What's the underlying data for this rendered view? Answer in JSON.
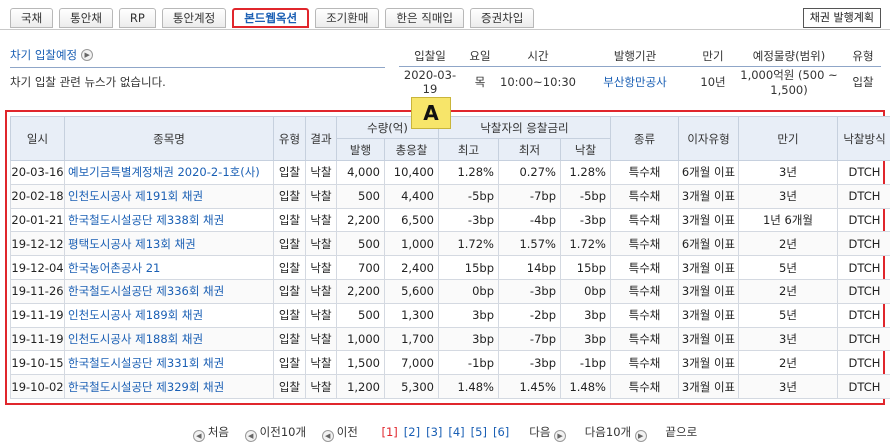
{
  "tabs": [
    "국채",
    "통안채",
    "RP",
    "통안계정",
    "본드웹옥션",
    "조기환매",
    "한은 직매입",
    "증권차입"
  ],
  "plan_button": "채권 발행계획",
  "upcoming": {
    "title": "차기 입찰예정",
    "news": "차기 입찰 관련 뉴스가 없습니다.",
    "headers": [
      "입찰일",
      "요일",
      "시간",
      "발행기관",
      "만기",
      "예정물량(범위)",
      "유형"
    ],
    "row": [
      "2020-03-19",
      "목",
      "10:00~10:30",
      "부산항만공사",
      "10년",
      "1,000억원 (500 ~ 1,500)",
      "입찰"
    ]
  },
  "marker": "A",
  "table": {
    "headers": {
      "date": "일시",
      "name": "종목명",
      "type": "유형",
      "result": "결과",
      "qty": "수량(억)",
      "issue": "발행",
      "total_bid": "총응찰",
      "rate": "낙찰자의 응찰금리",
      "high": "최고",
      "low": "최저",
      "win": "낙찰",
      "kind": "종류",
      "interest": "이자유형",
      "maturity": "만기",
      "method": "낙찰방식"
    },
    "rows": [
      {
        "date": "20-03-16",
        "name": "예보기금특별계정채권 2020-2-1호(사)",
        "type": "입찰",
        "result": "낙찰",
        "issue": "4,000",
        "total": "10,400",
        "high": "1.28%",
        "low": "0.27%",
        "win": "1.28%",
        "kind": "특수채",
        "interest": "6개월 이표",
        "maturity": "3년",
        "method": "DTCH"
      },
      {
        "date": "20-02-18",
        "name": "인천도시공사 제191회 채권",
        "type": "입찰",
        "result": "낙찰",
        "issue": "500",
        "total": "4,400",
        "high": "-5bp",
        "low": "-7bp",
        "win": "-5bp",
        "kind": "특수채",
        "interest": "3개월 이표",
        "maturity": "3년",
        "method": "DTCH"
      },
      {
        "date": "20-01-21",
        "name": "한국철도시설공단 제338회 채권",
        "type": "입찰",
        "result": "낙찰",
        "issue": "2,200",
        "total": "6,500",
        "high": "-3bp",
        "low": "-4bp",
        "win": "-3bp",
        "kind": "특수채",
        "interest": "3개월 이표",
        "maturity": "1년 6개월",
        "method": "DTCH"
      },
      {
        "date": "19-12-12",
        "name": "평택도시공사 제13회 채권",
        "type": "입찰",
        "result": "낙찰",
        "issue": "500",
        "total": "1,000",
        "high": "1.72%",
        "low": "1.57%",
        "win": "1.72%",
        "kind": "특수채",
        "interest": "6개월 이표",
        "maturity": "2년",
        "method": "DTCH"
      },
      {
        "date": "19-12-04",
        "name": "한국농어촌공사 21",
        "type": "입찰",
        "result": "낙찰",
        "issue": "700",
        "total": "2,400",
        "high": "15bp",
        "low": "14bp",
        "win": "15bp",
        "kind": "특수채",
        "interest": "3개월 이표",
        "maturity": "5년",
        "method": "DTCH"
      },
      {
        "date": "19-11-26",
        "name": "한국철도시설공단 제336회 채권",
        "type": "입찰",
        "result": "낙찰",
        "issue": "2,200",
        "total": "5,600",
        "high": "0bp",
        "low": "-3bp",
        "win": "0bp",
        "kind": "특수채",
        "interest": "3개월 이표",
        "maturity": "2년",
        "method": "DTCH"
      },
      {
        "date": "19-11-19",
        "name": "인천도시공사 제189회 채권",
        "type": "입찰",
        "result": "낙찰",
        "issue": "500",
        "total": "1,300",
        "high": "3bp",
        "low": "-2bp",
        "win": "3bp",
        "kind": "특수채",
        "interest": "3개월 이표",
        "maturity": "5년",
        "method": "DTCH"
      },
      {
        "date": "19-11-19",
        "name": "인천도시공사 제188회 채권",
        "type": "입찰",
        "result": "낙찰",
        "issue": "1,000",
        "total": "1,700",
        "high": "3bp",
        "low": "-7bp",
        "win": "3bp",
        "kind": "특수채",
        "interest": "3개월 이표",
        "maturity": "3년",
        "method": "DTCH"
      },
      {
        "date": "19-10-15",
        "name": "한국철도시설공단 제331회 채권",
        "type": "입찰",
        "result": "낙찰",
        "issue": "1,500",
        "total": "7,000",
        "high": "-1bp",
        "low": "-3bp",
        "win": "-1bp",
        "kind": "특수채",
        "interest": "3개월 이표",
        "maturity": "2년",
        "method": "DTCH"
      },
      {
        "date": "19-10-02",
        "name": "한국철도시설공단 제329회 채권",
        "type": "입찰",
        "result": "낙찰",
        "issue": "1,200",
        "total": "5,300",
        "high": "1.48%",
        "low": "1.45%",
        "win": "1.48%",
        "kind": "특수채",
        "interest": "3개월 이표",
        "maturity": "3년",
        "method": "DTCH"
      }
    ]
  },
  "pager": {
    "first": "처음",
    "prev10": "이전10개",
    "prev": "이전",
    "pages": [
      "[1]",
      "[2]",
      "[3]",
      "[4]",
      "[5]",
      "[6]"
    ],
    "next": "다음",
    "next10": "다음10개",
    "last": "끝으로"
  }
}
